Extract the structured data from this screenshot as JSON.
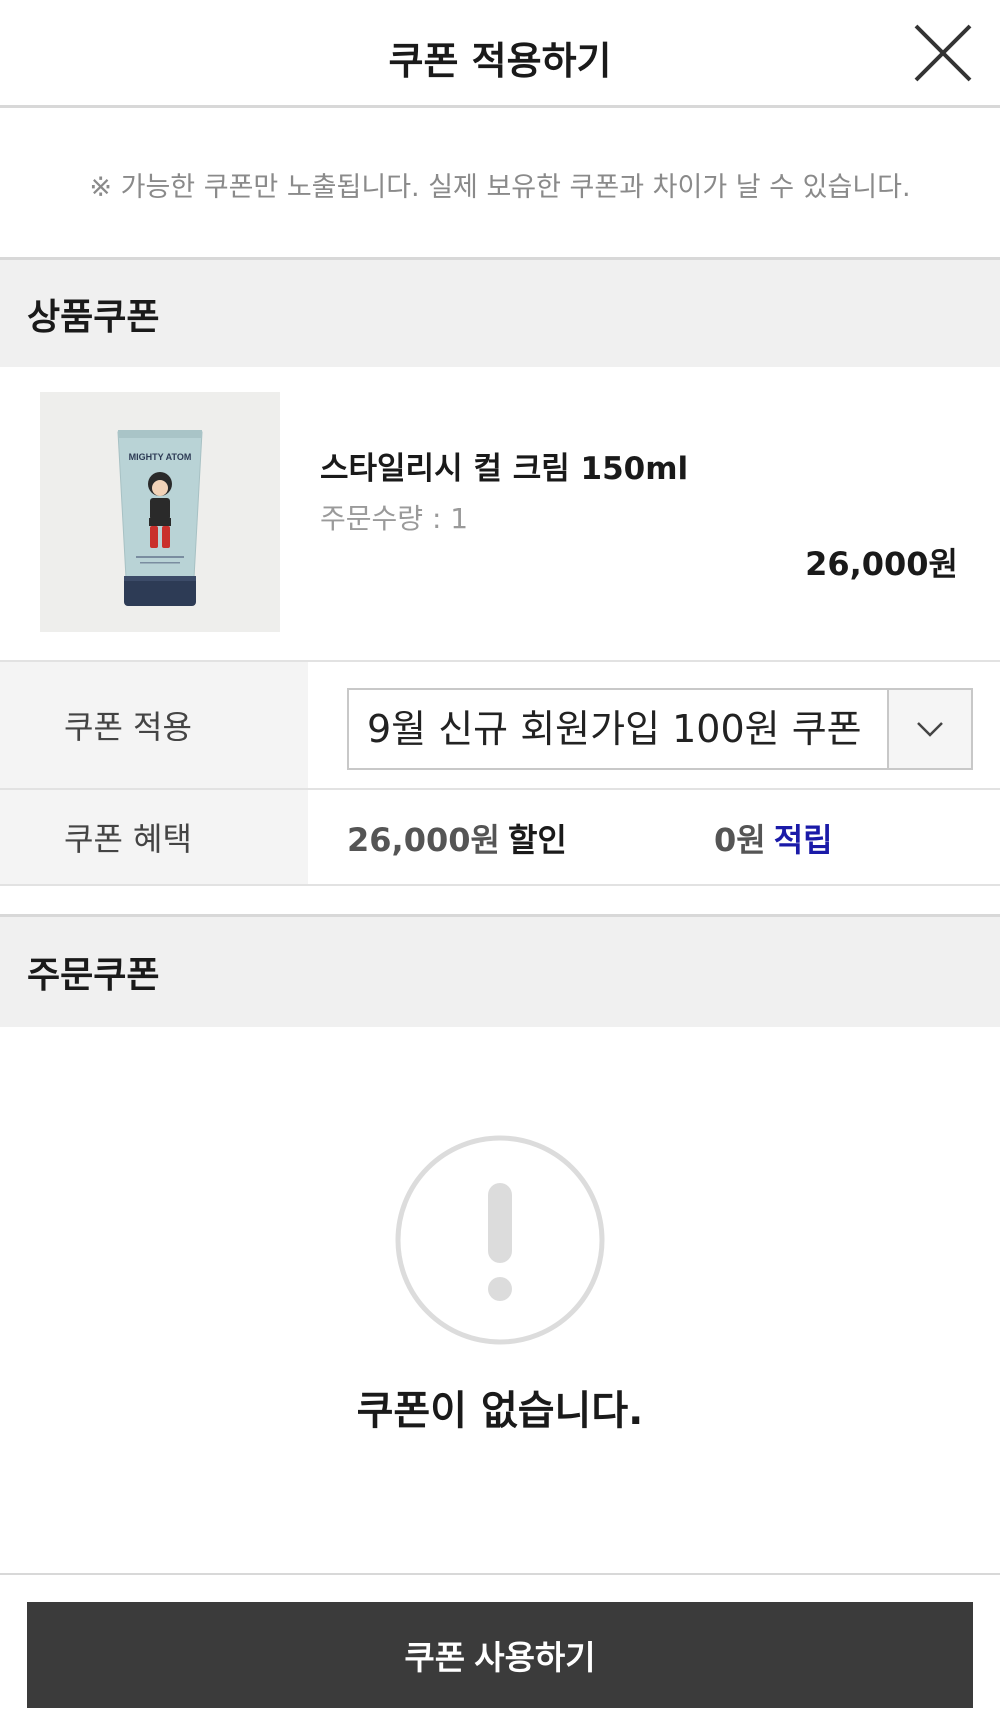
{
  "header": {
    "title": "쿠폰 적용하기",
    "close_icon": "close-icon"
  },
  "notice": {
    "text": "※ 가능한 쿠폰만 노출됩니다. 실제 보유한 쿠폰과 차이가 날 수 있습니다."
  },
  "product_coupon": {
    "section_title": "상품쿠폰",
    "product": {
      "name": "스타일리시 컬 크림 150ml",
      "quantity": "주문수량 : 1",
      "price": "26,000원",
      "image_brand_text": "MIGHTY ATOM"
    },
    "apply": {
      "label": "쿠폰 적용",
      "selected": "9월 신규 회원가입 100원 쿠폰",
      "arrow_icon": "chevron-down-icon"
    },
    "benefit": {
      "label": "쿠폰 혜택",
      "discount_amount": "26,000원",
      "discount_label": "할인",
      "points_amount": "0원",
      "points_label": "적립"
    }
  },
  "order_coupon": {
    "section_title": "주문쿠폰",
    "empty_icon": "exclamation-circle-icon",
    "empty_text": "쿠폰이 없습니다."
  },
  "footer": {
    "submit_label": "쿠폰 사용하기"
  },
  "colors": {
    "button_bg": "#3b3b3b",
    "section_bg": "#f0f0f0",
    "points_accent": "#1a1aa8"
  }
}
